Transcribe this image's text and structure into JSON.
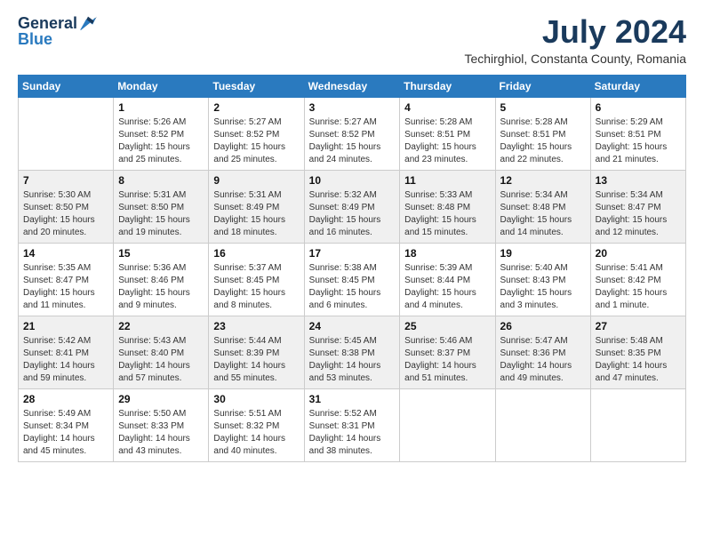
{
  "logo": {
    "general": "General",
    "blue": "Blue"
  },
  "title": {
    "month": "July 2024",
    "location": "Techirghiol, Constanta County, Romania"
  },
  "headers": [
    "Sunday",
    "Monday",
    "Tuesday",
    "Wednesday",
    "Thursday",
    "Friday",
    "Saturday"
  ],
  "weeks": [
    [
      {
        "day": "",
        "info": ""
      },
      {
        "day": "1",
        "info": "Sunrise: 5:26 AM\nSunset: 8:52 PM\nDaylight: 15 hours\nand 25 minutes."
      },
      {
        "day": "2",
        "info": "Sunrise: 5:27 AM\nSunset: 8:52 PM\nDaylight: 15 hours\nand 25 minutes."
      },
      {
        "day": "3",
        "info": "Sunrise: 5:27 AM\nSunset: 8:52 PM\nDaylight: 15 hours\nand 24 minutes."
      },
      {
        "day": "4",
        "info": "Sunrise: 5:28 AM\nSunset: 8:51 PM\nDaylight: 15 hours\nand 23 minutes."
      },
      {
        "day": "5",
        "info": "Sunrise: 5:28 AM\nSunset: 8:51 PM\nDaylight: 15 hours\nand 22 minutes."
      },
      {
        "day": "6",
        "info": "Sunrise: 5:29 AM\nSunset: 8:51 PM\nDaylight: 15 hours\nand 21 minutes."
      }
    ],
    [
      {
        "day": "7",
        "info": "Sunrise: 5:30 AM\nSunset: 8:50 PM\nDaylight: 15 hours\nand 20 minutes."
      },
      {
        "day": "8",
        "info": "Sunrise: 5:31 AM\nSunset: 8:50 PM\nDaylight: 15 hours\nand 19 minutes."
      },
      {
        "day": "9",
        "info": "Sunrise: 5:31 AM\nSunset: 8:49 PM\nDaylight: 15 hours\nand 18 minutes."
      },
      {
        "day": "10",
        "info": "Sunrise: 5:32 AM\nSunset: 8:49 PM\nDaylight: 15 hours\nand 16 minutes."
      },
      {
        "day": "11",
        "info": "Sunrise: 5:33 AM\nSunset: 8:48 PM\nDaylight: 15 hours\nand 15 minutes."
      },
      {
        "day": "12",
        "info": "Sunrise: 5:34 AM\nSunset: 8:48 PM\nDaylight: 15 hours\nand 14 minutes."
      },
      {
        "day": "13",
        "info": "Sunrise: 5:34 AM\nSunset: 8:47 PM\nDaylight: 15 hours\nand 12 minutes."
      }
    ],
    [
      {
        "day": "14",
        "info": "Sunrise: 5:35 AM\nSunset: 8:47 PM\nDaylight: 15 hours\nand 11 minutes."
      },
      {
        "day": "15",
        "info": "Sunrise: 5:36 AM\nSunset: 8:46 PM\nDaylight: 15 hours\nand 9 minutes."
      },
      {
        "day": "16",
        "info": "Sunrise: 5:37 AM\nSunset: 8:45 PM\nDaylight: 15 hours\nand 8 minutes."
      },
      {
        "day": "17",
        "info": "Sunrise: 5:38 AM\nSunset: 8:45 PM\nDaylight: 15 hours\nand 6 minutes."
      },
      {
        "day": "18",
        "info": "Sunrise: 5:39 AM\nSunset: 8:44 PM\nDaylight: 15 hours\nand 4 minutes."
      },
      {
        "day": "19",
        "info": "Sunrise: 5:40 AM\nSunset: 8:43 PM\nDaylight: 15 hours\nand 3 minutes."
      },
      {
        "day": "20",
        "info": "Sunrise: 5:41 AM\nSunset: 8:42 PM\nDaylight: 15 hours\nand 1 minute."
      }
    ],
    [
      {
        "day": "21",
        "info": "Sunrise: 5:42 AM\nSunset: 8:41 PM\nDaylight: 14 hours\nand 59 minutes."
      },
      {
        "day": "22",
        "info": "Sunrise: 5:43 AM\nSunset: 8:40 PM\nDaylight: 14 hours\nand 57 minutes."
      },
      {
        "day": "23",
        "info": "Sunrise: 5:44 AM\nSunset: 8:39 PM\nDaylight: 14 hours\nand 55 minutes."
      },
      {
        "day": "24",
        "info": "Sunrise: 5:45 AM\nSunset: 8:38 PM\nDaylight: 14 hours\nand 53 minutes."
      },
      {
        "day": "25",
        "info": "Sunrise: 5:46 AM\nSunset: 8:37 PM\nDaylight: 14 hours\nand 51 minutes."
      },
      {
        "day": "26",
        "info": "Sunrise: 5:47 AM\nSunset: 8:36 PM\nDaylight: 14 hours\nand 49 minutes."
      },
      {
        "day": "27",
        "info": "Sunrise: 5:48 AM\nSunset: 8:35 PM\nDaylight: 14 hours\nand 47 minutes."
      }
    ],
    [
      {
        "day": "28",
        "info": "Sunrise: 5:49 AM\nSunset: 8:34 PM\nDaylight: 14 hours\nand 45 minutes."
      },
      {
        "day": "29",
        "info": "Sunrise: 5:50 AM\nSunset: 8:33 PM\nDaylight: 14 hours\nand 43 minutes."
      },
      {
        "day": "30",
        "info": "Sunrise: 5:51 AM\nSunset: 8:32 PM\nDaylight: 14 hours\nand 40 minutes."
      },
      {
        "day": "31",
        "info": "Sunrise: 5:52 AM\nSunset: 8:31 PM\nDaylight: 14 hours\nand 38 minutes."
      },
      {
        "day": "",
        "info": ""
      },
      {
        "day": "",
        "info": ""
      },
      {
        "day": "",
        "info": ""
      }
    ]
  ]
}
